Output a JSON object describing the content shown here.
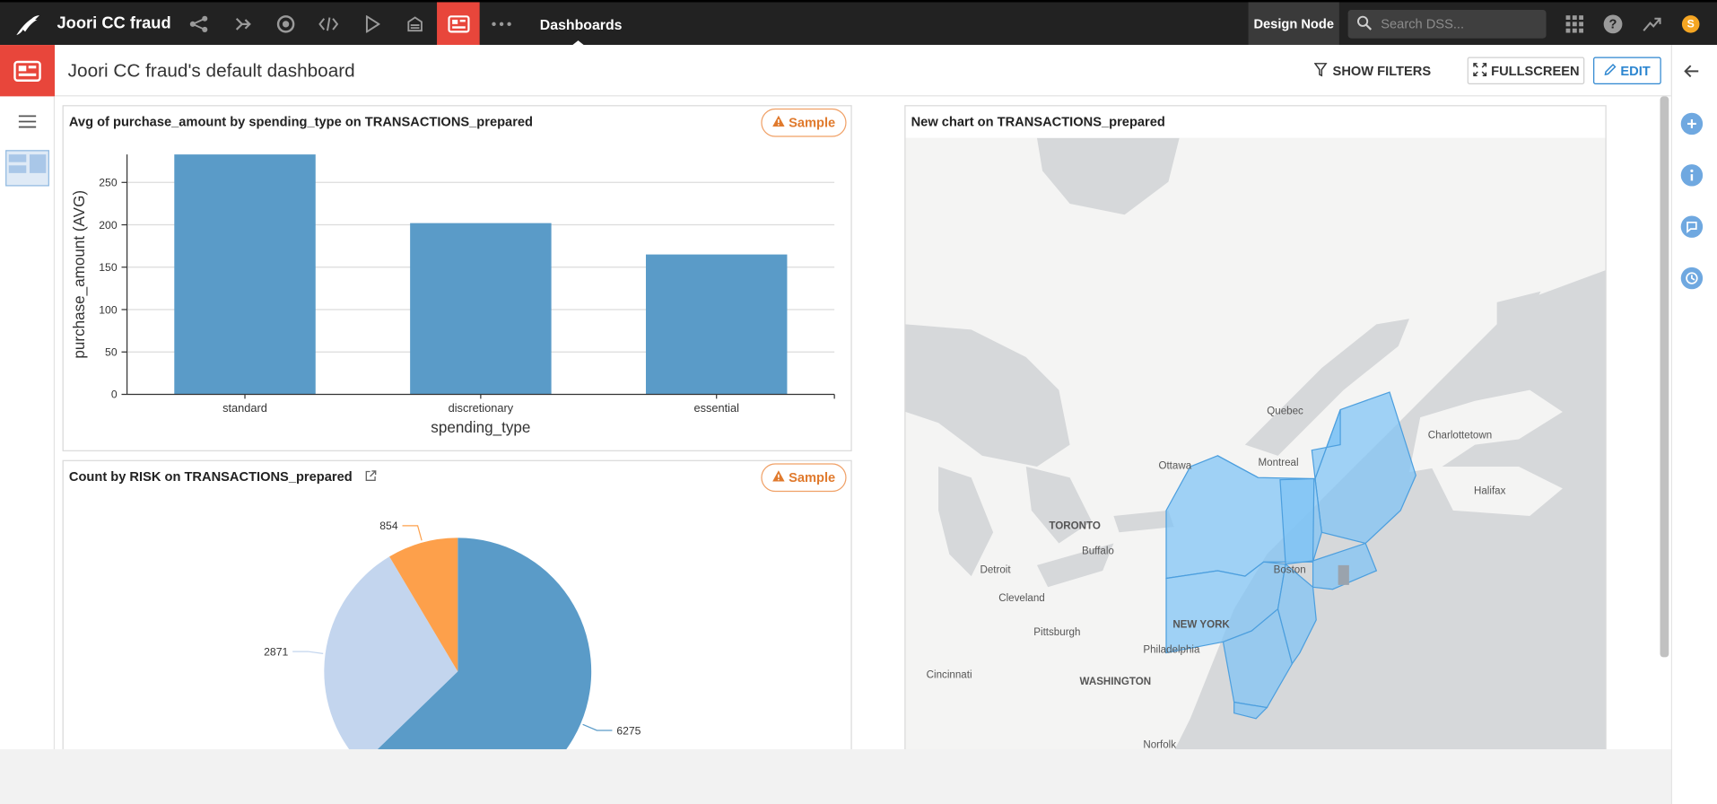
{
  "app": {
    "project_name": "Joori CC fraud",
    "section": "Dashboards",
    "design_node": "Design Node",
    "search_placeholder": "Search DSS...",
    "avatar_letter": "S"
  },
  "header": {
    "title": "Joori CC fraud's default dashboard",
    "show_filters": "SHOW FILTERS",
    "fullscreen": "FULLSCREEN",
    "edit": "EDIT"
  },
  "colors": {
    "accent": "#e8463b",
    "bar": "#5a9bc8",
    "pie_high": "#5a9bc8",
    "pie_mid": "#c3d5ee",
    "pie_low": "#fda04b",
    "sample_badge": "#e07a2d",
    "map_region": "#7ec4f5"
  },
  "panels": {
    "bar": {
      "title": "Avg of purchase_amount by spending_type on TRANSACTIONS_prepared",
      "badge": "Sample"
    },
    "pie": {
      "title": "Count by RISK on TRANSACTIONS_prepared",
      "badge": "Sample"
    },
    "map": {
      "title": "New chart on TRANSACTIONS_prepared"
    }
  },
  "chart_data": [
    {
      "type": "bar",
      "categories": [
        "standard",
        "discretionary",
        "essential"
      ],
      "values": [
        283,
        202,
        165
      ],
      "xlabel": "spending_type",
      "ylabel": "purchase_amount (AVG)",
      "ylim": [
        0,
        283
      ],
      "yticks": [
        0,
        50,
        100,
        150,
        200,
        250
      ],
      "grid": true
    },
    {
      "type": "pie",
      "slices": [
        {
          "label": "6275",
          "value": 6275,
          "color": "#5a9bc8"
        },
        {
          "label": "2871",
          "value": 2871,
          "color": "#c3d5ee"
        },
        {
          "label": "854",
          "value": 854,
          "color": "#fda04b"
        }
      ]
    }
  ],
  "map": {
    "labels": [
      "Quebec",
      "Charlottetown",
      "Ottawa",
      "Montreal",
      "Halifax",
      "TORONTO",
      "Buffalo",
      "Boston",
      "Detroit",
      "Cleveland",
      "NEW YORK",
      "Pittsburgh",
      "Philadelphia",
      "Cincinnati",
      "WASHINGTON",
      "Norfolk"
    ]
  },
  "rail": {
    "icons": [
      "back-arrow-icon",
      "add-icon",
      "info-icon",
      "discussion-icon",
      "history-icon"
    ]
  }
}
